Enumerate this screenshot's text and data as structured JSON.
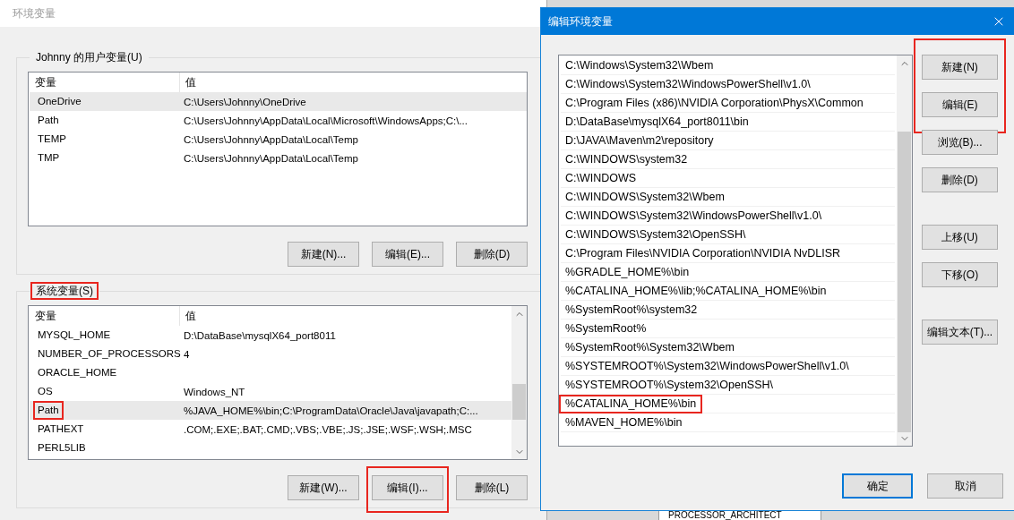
{
  "env_window": {
    "title": "环境变量",
    "user_group": {
      "label": "Johnny 的用户变量(U)",
      "highlighted": false,
      "columns": [
        "变量",
        "值"
      ],
      "rows": [
        {
          "name": "OneDrive",
          "value": "C:\\Users\\Johnny\\OneDrive",
          "selected": true,
          "highlighted": false
        },
        {
          "name": "Path",
          "value": "C:\\Users\\Johnny\\AppData\\Local\\Microsoft\\WindowsApps;C:\\...",
          "selected": false,
          "highlighted": false
        },
        {
          "name": "TEMP",
          "value": "C:\\Users\\Johnny\\AppData\\Local\\Temp",
          "selected": false,
          "highlighted": false
        },
        {
          "name": "TMP",
          "value": "C:\\Users\\Johnny\\AppData\\Local\\Temp",
          "selected": false,
          "highlighted": false
        }
      ],
      "buttons": [
        {
          "label": "新建(N)...",
          "highlighted": false
        },
        {
          "label": "编辑(E)...",
          "highlighted": false
        },
        {
          "label": "删除(D)",
          "highlighted": false
        }
      ]
    },
    "system_group": {
      "label": "系统变量(S)",
      "highlighted": true,
      "columns": [
        "变量",
        "值"
      ],
      "rows": [
        {
          "name": "MYSQL_HOME",
          "value": "D:\\DataBase\\mysqlX64_port8011",
          "selected": false,
          "highlighted": false
        },
        {
          "name": "NUMBER_OF_PROCESSORS",
          "value": "4",
          "selected": false,
          "highlighted": false
        },
        {
          "name": "ORACLE_HOME",
          "value": "",
          "selected": false,
          "highlighted": false
        },
        {
          "name": "OS",
          "value": "Windows_NT",
          "selected": false,
          "highlighted": false
        },
        {
          "name": "Path",
          "value": "%JAVA_HOME%\\bin;C:\\ProgramData\\Oracle\\Java\\javapath;C:...",
          "selected": true,
          "highlighted": true
        },
        {
          "name": "PATHEXT",
          "value": ".COM;.EXE;.BAT;.CMD;.VBS;.VBE;.JS;.JSE;.WSF;.WSH;.MSC",
          "selected": false,
          "highlighted": false
        },
        {
          "name": "PERL5LIB",
          "value": "",
          "selected": false,
          "highlighted": false
        }
      ],
      "buttons": [
        {
          "label": "新建(W)...",
          "highlighted": false
        },
        {
          "label": "编辑(I)...",
          "highlighted": true
        },
        {
          "label": "删除(L)",
          "highlighted": false
        }
      ]
    }
  },
  "edit_dialog": {
    "title": "编辑环境变量",
    "entries": [
      {
        "text": "C:\\Windows\\System32\\Wbem",
        "highlighted": false
      },
      {
        "text": "C:\\Windows\\System32\\WindowsPowerShell\\v1.0\\",
        "highlighted": false
      },
      {
        "text": "C:\\Program Files (x86)\\NVIDIA Corporation\\PhysX\\Common",
        "highlighted": false
      },
      {
        "text": "D:\\DataBase\\mysqlX64_port8011\\bin",
        "highlighted": false
      },
      {
        "text": "D:\\JAVA\\Maven\\m2\\repository",
        "highlighted": false
      },
      {
        "text": "C:\\WINDOWS\\system32",
        "highlighted": false
      },
      {
        "text": "C:\\WINDOWS",
        "highlighted": false
      },
      {
        "text": "C:\\WINDOWS\\System32\\Wbem",
        "highlighted": false
      },
      {
        "text": "C:\\WINDOWS\\System32\\WindowsPowerShell\\v1.0\\",
        "highlighted": false
      },
      {
        "text": "C:\\WINDOWS\\System32\\OpenSSH\\",
        "highlighted": false
      },
      {
        "text": "C:\\Program Files\\NVIDIA Corporation\\NVIDIA NvDLISR",
        "highlighted": false
      },
      {
        "text": "%GRADLE_HOME%\\bin",
        "highlighted": false
      },
      {
        "text": "%CATALINA_HOME%\\lib;%CATALINA_HOME%\\bin",
        "highlighted": false
      },
      {
        "text": "%SystemRoot%\\system32",
        "highlighted": false
      },
      {
        "text": "%SystemRoot%",
        "highlighted": false
      },
      {
        "text": "%SystemRoot%\\System32\\Wbem",
        "highlighted": false
      },
      {
        "text": "%SYSTEMROOT%\\System32\\WindowsPowerShell\\v1.0\\",
        "highlighted": false
      },
      {
        "text": "%SYSTEMROOT%\\System32\\OpenSSH\\",
        "highlighted": false
      },
      {
        "text": "%CATALINA_HOME%\\bin",
        "highlighted": true
      },
      {
        "text": "%MAVEN_HOME%\\bin",
        "highlighted": false
      }
    ],
    "button_groups": [
      [
        {
          "label": "新建(N)",
          "highlighted": true
        },
        {
          "label": "编辑(E)",
          "highlighted": true
        },
        {
          "label": "浏览(B)...",
          "highlighted": false
        },
        {
          "label": "删除(D)",
          "highlighted": false
        }
      ],
      [
        {
          "label": "上移(U)",
          "highlighted": false
        },
        {
          "label": "下移(O)",
          "highlighted": false
        }
      ],
      [
        {
          "label": "编辑文本(T)...",
          "highlighted": false
        }
      ]
    ],
    "ok": "确定",
    "cancel": "取消"
  },
  "background_window": {
    "text": "PROCESSOR_ARCHITECT"
  }
}
